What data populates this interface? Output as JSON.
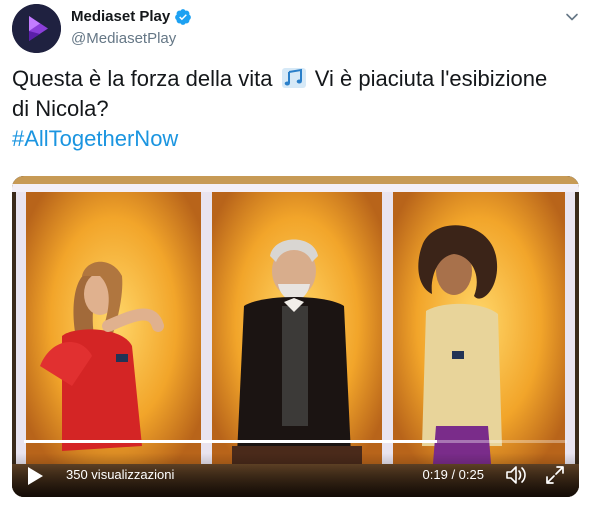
{
  "tweet": {
    "display_name": "Mediaset Play",
    "handle": "@MediasetPlay",
    "text_line1_before_icon": "Questa è la forza della vita",
    "text_line1_after_icon": "Vi è piaciuta l'esibizione",
    "text_line2": "di Nicola?",
    "hashtag": "#AllTogetherNow",
    "icons": {
      "verified": "verified-badge-icon",
      "music": "musical-notes-icon",
      "menu": "chevron-down-icon"
    }
  },
  "video": {
    "views": "350 visualizzazioni",
    "time": "0:19 / 0:25",
    "progress_fraction": 0.76,
    "icons": {
      "play": "play-icon",
      "volume": "volume-icon",
      "fullscreen": "fullscreen-icon"
    }
  },
  "colors": {
    "link": "#1b95e0",
    "verified": "#1da1f2",
    "handle": "#657786",
    "text": "#14171a"
  }
}
